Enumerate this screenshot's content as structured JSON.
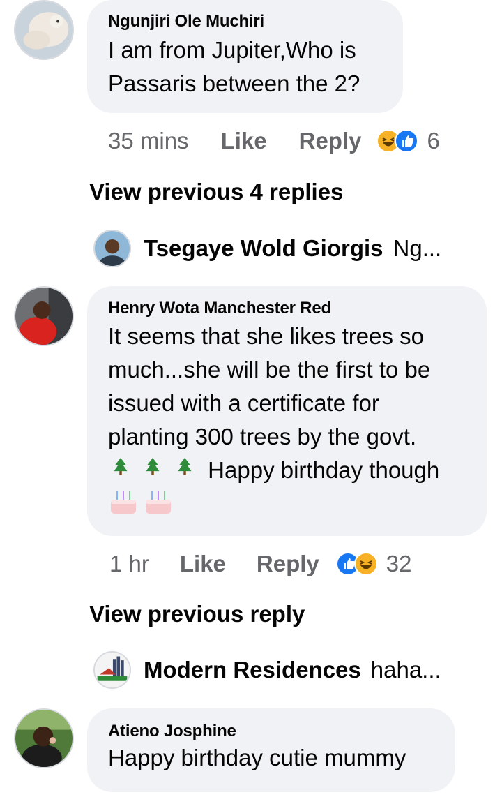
{
  "comments": [
    {
      "author": "Ngunjiri Ole Muchiri",
      "lines": [
        "I am from Jupiter,Who is",
        "Passaris between the 2?"
      ],
      "time": "35 mins",
      "like": "Like",
      "reply": "Reply",
      "reactions": [
        "haha",
        "like"
      ],
      "reaction_count": "6"
    },
    {
      "author": "Henry Wota Manchester Red",
      "lines": [
        "It seems that she likes trees so",
        "much...she will be the first to be",
        "issued with a certificate for",
        "planting 300 trees by the govt."
      ],
      "emoji_line_text": "Happy birthday though",
      "time": "1 hr",
      "like": "Like",
      "reply": "Reply",
      "reactions": [
        "like",
        "haha"
      ],
      "reaction_count": "32"
    },
    {
      "author": "Atieno Josphine",
      "lines": [
        "Happy birthday cutie mummy"
      ]
    }
  ],
  "view_previous": [
    {
      "label": "View previous 4 replies"
    },
    {
      "label": "View previous reply"
    }
  ],
  "reply_previews": [
    {
      "name": "Tsegaye Wold Giorgis",
      "text": "Ng..."
    },
    {
      "name": "Modern Residences",
      "text": "haha..."
    }
  ],
  "colors": {
    "bubble": "#f0f2f5",
    "meta_text": "#65676b",
    "like_blue": "#1877f2",
    "haha_yellow": "#f7b125"
  }
}
